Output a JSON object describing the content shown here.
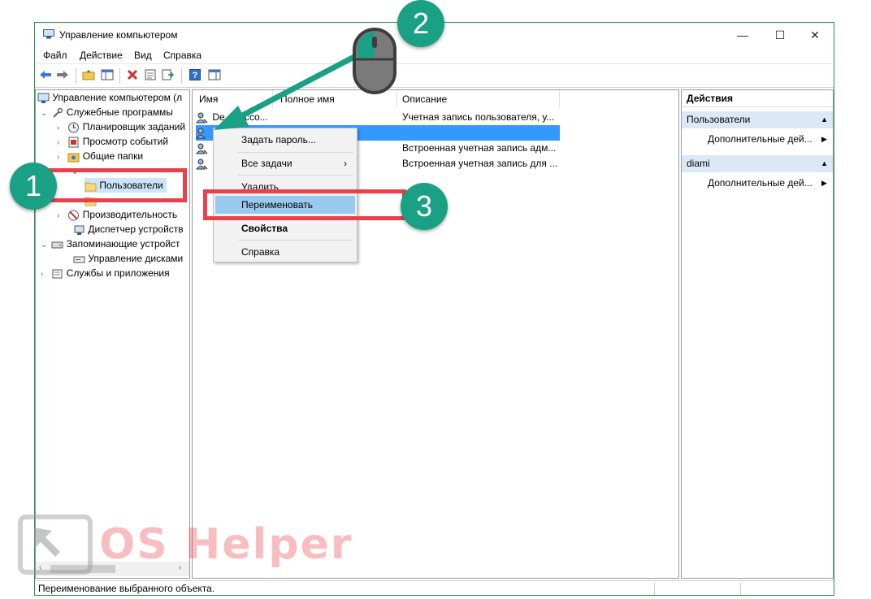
{
  "window": {
    "title": "Управление компьютером",
    "minimize_glyph": "—",
    "maximize_glyph": "☐",
    "close_glyph": "✕"
  },
  "menu": [
    "Файл",
    "Действие",
    "Вид",
    "Справка"
  ],
  "tree": {
    "root": "Управление компьютером (л",
    "items": [
      {
        "label": "Служебные программы"
      },
      {
        "label": "Планировщик заданий"
      },
      {
        "label": "Просмотр событий"
      },
      {
        "label": "Общие папки"
      },
      {
        "label": "Пользователи"
      },
      {
        "label": "Производительность"
      },
      {
        "label": "Диспетчер устройств"
      },
      {
        "label": "Запоминающие устройст"
      },
      {
        "label": "Управление дисками"
      },
      {
        "label": "Службы и приложения"
      }
    ]
  },
  "list": {
    "columns": [
      "Имя",
      "Полное имя",
      "Описание"
    ],
    "rows": [
      {
        "name": "De",
        "fullname": "Acco...",
        "desc": "Учетная запись пользователя, у..."
      },
      {
        "name": "",
        "fullname": "",
        "desc": ""
      },
      {
        "name": "",
        "fullname": "",
        "desc": "Встроенная учетная запись адм..."
      },
      {
        "name": "",
        "fullname": "",
        "desc": "Встроенная учетная запись для ..."
      }
    ]
  },
  "context_menu": {
    "items": [
      {
        "label": "Задать пароль..."
      },
      {
        "label": "Все задачи",
        "arrow": "›"
      },
      {
        "label": "Удалить"
      },
      {
        "label": "Переименовать"
      },
      {
        "label": "Свойства"
      },
      {
        "label": "Справка"
      }
    ]
  },
  "actions": {
    "title": "Действия",
    "sections": [
      {
        "title": "Пользователи",
        "item": "Дополнительные дей..."
      },
      {
        "title": "diami",
        "item": "Дополнительные дей..."
      }
    ]
  },
  "status": "Переименование выбранного объекта.",
  "annotations": {
    "step1": "1",
    "step2": "2",
    "step3": "3"
  },
  "watermark": "OS Helper",
  "colors": {
    "accent": "#1aa085",
    "highlight": "#e8414b",
    "selection": "#99c9ef",
    "arrow": "#1aa085"
  }
}
